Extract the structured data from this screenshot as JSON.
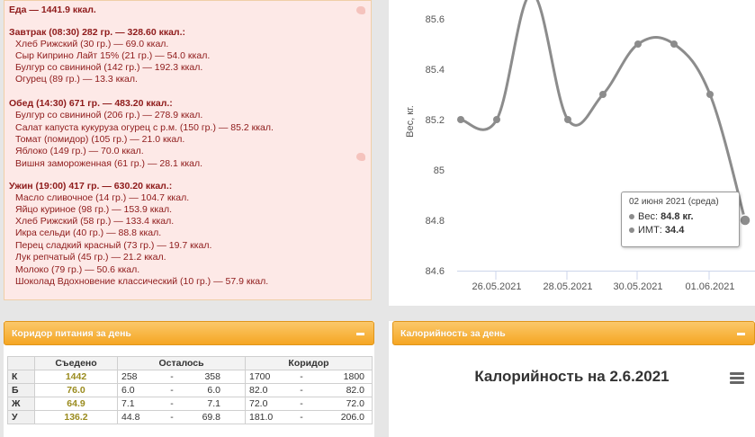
{
  "food": {
    "header": "Еда — 1441.9 ккал.",
    "meals": [
      {
        "title": "Завтрак (08:30) 282 гр. — 328.60 ккал.:",
        "items": [
          "Хлеб Рижский (30 гр.) — 69.0 ккал.",
          "Сыр Киприно Лайт 15% (21 гр.) — 54.0 ккал.",
          "Булгур со свининой (142 гр.) — 192.3 ккал.",
          "Огурец (89 гр.) — 13.3 ккал."
        ]
      },
      {
        "title": "Обед (14:30) 671 гр. — 483.20 ккал.:",
        "items": [
          "Булгур со свининой (206 гр.) — 278.9 ккал.",
          "Салат капуста кукуруза огурец с р.м. (150 гр.) — 85.2 ккал.",
          "Томат (помидор) (105 гр.) — 21.0 ккал.",
          "Яблоко (149 гр.) — 70.0 ккал.",
          "Вишня замороженная (61 гр.) — 28.1 ккал."
        ]
      },
      {
        "title": "Ужин (19:00) 417 гр. — 630.20 ккал.:",
        "items": [
          "Масло сливочное (14 гр.) — 104.7 ккал.",
          "Яйцо куриное (98 гр.) — 153.9 ккал.",
          "Хлеб Рижский (58 гр.) — 133.4 ккал.",
          "Икра сельди (40 гр.) — 88.8 ккал.",
          "Перец сладкий красный (73 гр.) — 19.7 ккал.",
          "Лук репчатый (45 гр.) — 21.2 ккал.",
          "Молоко (79 гр.) — 50.6 ккал.",
          "Шоколад Вдохновение классический (10 гр.) — 57.9 ккал."
        ]
      }
    ]
  },
  "chart_data": {
    "type": "line",
    "ylabel": "Вес, кг.",
    "ylim": [
      84.6,
      85.65
    ],
    "yticks": [
      "85.6",
      "85.4",
      "85.2",
      "85",
      "84.8",
      "84.6"
    ],
    "xticks": [
      "26.05.2021",
      "28.05.2021",
      "30.05.2021",
      "01.06.2021"
    ],
    "series": [
      {
        "x": [
          "25.05.2021",
          "26.05.2021",
          "27.05.2021",
          "28.05.2021",
          "29.05.2021",
          "30.05.2021",
          "31.05.2021",
          "01.06.2021",
          "02.06.2021"
        ],
        "values": [
          85.2,
          85.2,
          85.7,
          85.2,
          85.3,
          85.5,
          85.5,
          85.3,
          84.8
        ]
      }
    ],
    "color": "#8c8c8c",
    "tooltip": {
      "date": "02 июня 2021 (среда)",
      "weight_label": "Вес:",
      "weight_value": "84.8 кг.",
      "bmi_label": "ИМТ:",
      "bmi_value": "34.4"
    }
  },
  "corridor": {
    "title": "Коридор питания за день",
    "columns": [
      "Съедено",
      "Осталось",
      "Коридор"
    ],
    "rows": [
      {
        "label": "К",
        "eaten": "1442",
        "left_min": "258",
        "left_max": "358",
        "corr_min": "1700",
        "corr_max": "1800"
      },
      {
        "label": "Б",
        "eaten": "76.0",
        "left_min": "6.0",
        "left_max": "6.0",
        "corr_min": "82.0",
        "corr_max": "82.0"
      },
      {
        "label": "Ж",
        "eaten": "64.9",
        "left_min": "7.1",
        "left_max": "7.1",
        "corr_min": "72.0",
        "corr_max": "72.0"
      },
      {
        "label": "У",
        "eaten": "136.2",
        "left_min": "44.8",
        "left_max": "69.8",
        "corr_min": "181.0",
        "corr_max": "206.0"
      }
    ],
    "dash": "-"
  },
  "calories": {
    "header": "Калорийность за день",
    "title": "Калорийность на 2.6.2021"
  },
  "colors": {
    "header_orange": "#f5a623",
    "food_text": "#8e1a1a",
    "eaten_text": "#9a8b1e"
  }
}
